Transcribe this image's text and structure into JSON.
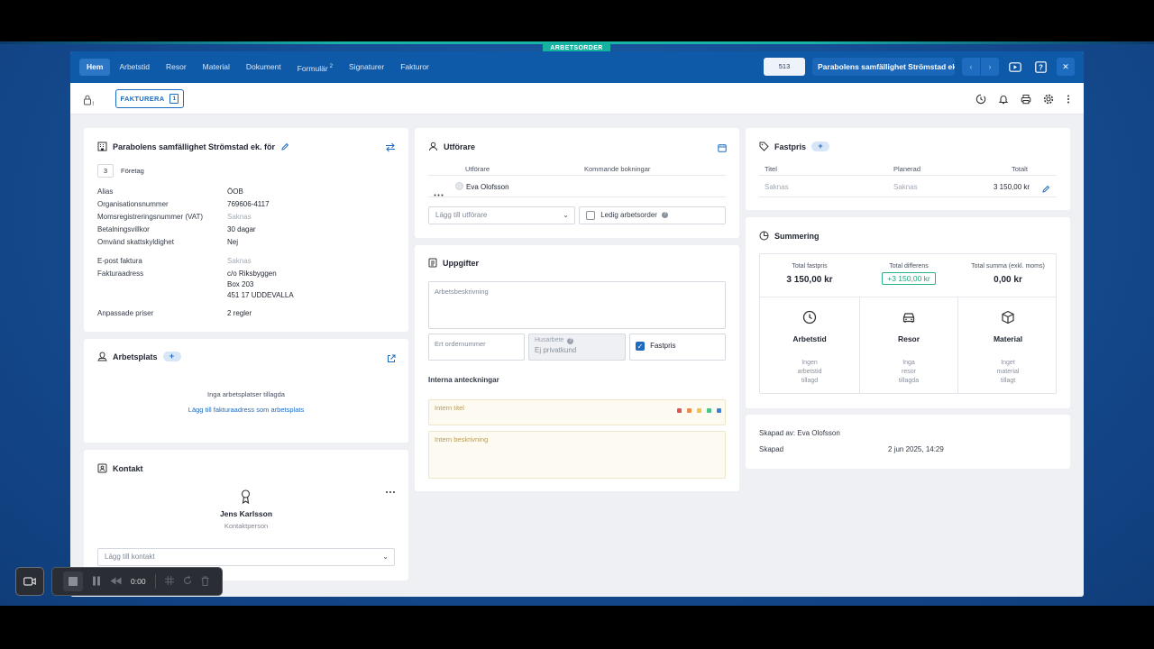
{
  "ribbon": "ARBETSORDER",
  "nav": {
    "tabs": [
      {
        "label": "Hem"
      },
      {
        "label": "Arbetstid"
      },
      {
        "label": "Resor"
      },
      {
        "label": "Material"
      },
      {
        "label": "Dokument"
      },
      {
        "label": "Formulär",
        "badge": "2"
      },
      {
        "label": "Signaturer"
      },
      {
        "label": "Fakturor"
      }
    ],
    "order_number": "513",
    "order_title": "Parabolens samfällighet Strömstad ek...",
    "prev": "‹",
    "next": "›",
    "close": "✕"
  },
  "toolbar": {
    "invoice_label": "FAKTURERA",
    "invoice_count": "1"
  },
  "customer": {
    "title": "Parabolens samfällighet Strömstad ek. för",
    "number": "3",
    "type": "Företag",
    "rows": [
      {
        "label": "Alias",
        "value": "ÖOB",
        "muted": false
      },
      {
        "label": "Organisationsnummer",
        "value": "769606-4117",
        "muted": false
      },
      {
        "label": "Momsregistreringsnummer (VAT)",
        "value": "Saknas",
        "muted": true
      },
      {
        "label": "Betalningsvillkor",
        "value": "30 dagar",
        "muted": false
      },
      {
        "label": "Omvänd skattskyldighet",
        "value": "Nej",
        "muted": false
      }
    ],
    "email_label": "E-post faktura",
    "email_value": "Saknas",
    "address_label": "Fakturaadress",
    "address_lines": [
      "c/o Riksbyggen",
      "Box 203",
      "451 17 UDDEVALLA"
    ],
    "prices_label": "Anpassade priser",
    "prices_value": "2 regler"
  },
  "workplace": {
    "title": "Arbetsplats",
    "empty": "Inga arbetsplatser tillagda",
    "link": "Lägg till fakturaadress som arbetsplats"
  },
  "contact": {
    "title": "Kontakt",
    "name": "Jens Karlsson",
    "role": "Kontaktperson",
    "add_placeholder": "Lägg till kontakt"
  },
  "performer": {
    "title": "Utförare",
    "col_performer": "Utförare",
    "col_bookings": "Kommande bokningar",
    "name": "Eva Olofsson",
    "add_placeholder": "Lägg till utförare",
    "vacant_label": "Ledig arbetsorder"
  },
  "tasks": {
    "title": "Uppgifter",
    "description_placeholder": "Arbetsbeskrivning",
    "order_no_placeholder": "Ert ordernummer",
    "rot_label": "Husarbete",
    "rot_value": "Ej privatkund",
    "fixed_label": "Fastpris",
    "internal_title": "Interna anteckningar",
    "internal_title_placeholder": "Intern titel",
    "internal_desc_placeholder": "Intern beskrivning",
    "colors": [
      "#e05656",
      "#f08a4b",
      "#f2c14e",
      "#4cc38a",
      "#3b82d6"
    ]
  },
  "fixed_price": {
    "title": "Fastpris",
    "col_title": "Titel",
    "col_planned": "Planerad",
    "col_total": "Totalt",
    "row_title": "Saknas",
    "row_planned": "Saknas",
    "row_total": "3 150,00 kr"
  },
  "summary": {
    "title": "Summering",
    "total_fixed_label": "Total fastpris",
    "total_fixed": "3 150,00 kr",
    "total_diff_label": "Total differens",
    "total_diff": "+3 150,00 kr",
    "total_sum_label": "Total summa (exkl. moms)",
    "total_sum": "0,00 kr",
    "time_title": "Arbetstid",
    "time_sub": [
      "Ingen",
      "arbetstid",
      "tillagd"
    ],
    "travel_title": "Resor",
    "travel_sub": [
      "Inga",
      "resor",
      "tillagda"
    ],
    "material_title": "Material",
    "material_sub": [
      "Inget",
      "material",
      "tillagt"
    ]
  },
  "meta": {
    "created_by": "Skapad av: Eva Olofsson",
    "created_label": "Skapad",
    "created_value": "2 jun 2025, 14:29"
  },
  "recorder": {
    "time": "0:00"
  }
}
